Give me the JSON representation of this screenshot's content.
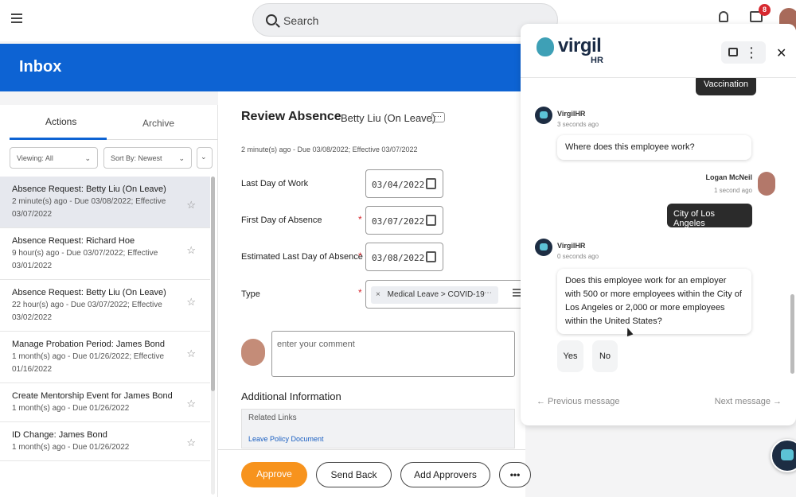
{
  "topbar": {
    "search_placeholder": "Search",
    "notification_count": "8"
  },
  "banner": {
    "title": "Inbox"
  },
  "tabs": {
    "actions": "Actions",
    "archive": "Archive"
  },
  "filters": {
    "viewing": "Viewing: All",
    "sort": "Sort By: Newest"
  },
  "inbox_items": [
    {
      "title": "Absence Request: Betty Liu (On Leave)",
      "meta": "2 minute(s) ago - Due 03/08/2022; Effective 03/07/2022"
    },
    {
      "title": "Absence Request: Richard Hoe",
      "meta": "9 hour(s) ago - Due 03/07/2022; Effective 03/01/2022"
    },
    {
      "title": "Absence Request: Betty Liu (On Leave)",
      "meta": "22 hour(s) ago - Due 03/07/2022; Effective 03/02/2022"
    },
    {
      "title": "Manage Probation Period: James Bond",
      "meta": "1 month(s) ago - Due 01/26/2022; Effective 01/16/2022"
    },
    {
      "title": "Create Mentorship Event for James Bond",
      "meta": "1 month(s) ago - Due 01/26/2022"
    },
    {
      "title": "ID Change: James Bond",
      "meta": "1 month(s) ago - Due 01/26/2022"
    }
  ],
  "review": {
    "title": "Review Absence",
    "person": "Betty Liu (On Leave)",
    "more": "⋯",
    "meta": "2 minute(s) ago - Due 03/08/2022; Effective 03/07/2022",
    "last_day_label": "Last Day of Work",
    "last_day_value": "03/04/2022",
    "first_day_label": "First Day of Absence",
    "first_day_value": "03/07/2022",
    "est_last_label": "Estimated Last Day of Absence",
    "est_last_value": "03/08/2022",
    "type_label": "Type",
    "type_value": "Medical Leave > COVID-19",
    "comment_placeholder": "enter your comment",
    "additional_info": "Additional Information",
    "related_links": "Related Links",
    "leave_policy": "Leave Policy Document"
  },
  "actions": {
    "approve": "Approve",
    "send_back": "Send Back",
    "add_approvers": "Add Approvers",
    "more": "•••"
  },
  "chat": {
    "logo": "virgil",
    "logo_sub": "HR",
    "prev_bubble": "Vaccination",
    "bot_name": "VirgilHR",
    "msg1_time": "3 seconds ago",
    "msg1": "Where does this employee work?",
    "user_name": "Logan McNeil",
    "user_time": "1 second ago",
    "user_msg": "City of Los Angeles",
    "msg2_time": "0 seconds ago",
    "msg2": "Does this employee work for an employer with 500 or more employees within the City of Los Angeles or 2,000 or more employees within the United States?",
    "reply_yes": "Yes",
    "reply_no": "No",
    "prev_nav": "← Previous message",
    "next_nav": "Next message →"
  },
  "colors": {
    "brand_blue": "#0d63d3",
    "approve_orange": "#f7931d",
    "badge_red": "#d7282f"
  }
}
